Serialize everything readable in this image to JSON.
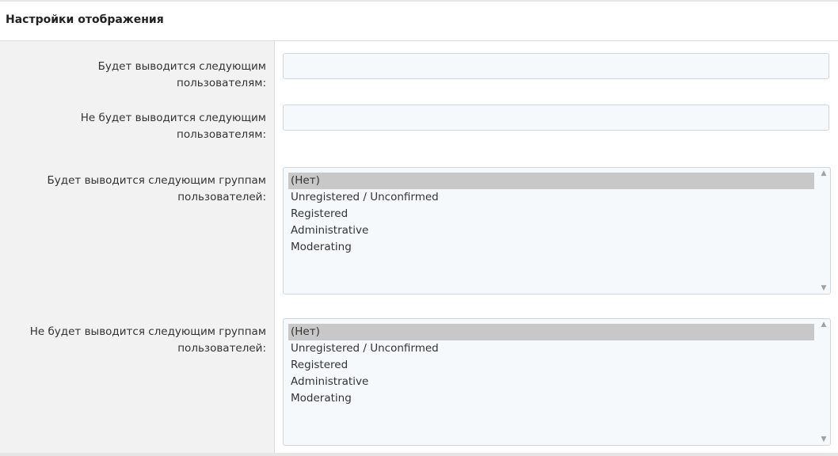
{
  "header": {
    "title": "Настройки отображения"
  },
  "fields": {
    "show_users": {
      "label": "Будет выводится следующим пользователям:",
      "value": ""
    },
    "hide_users": {
      "label_line1": "Не будет выводится следующим",
      "label_line2": "пользователям:",
      "value": ""
    },
    "show_groups": {
      "label_line1": "Будет выводится следующим группам",
      "label_line2": "пользователей:",
      "options": [
        "(Нет)",
        "Unregistered / Unconfirmed",
        "Registered",
        "Administrative",
        "Moderating"
      ],
      "selected": "(Нет)"
    },
    "hide_groups": {
      "label_line1": "Не будет выводится следующим группам",
      "label_line2": "пользователей:",
      "options": [
        "(Нет)",
        "Unregistered / Unconfirmed",
        "Registered",
        "Administrative",
        "Moderating"
      ],
      "selected": "(Нет)"
    }
  },
  "icons": {
    "scroll_up": "chevron-up-icon",
    "scroll_down": "chevron-down-icon"
  },
  "colors": {
    "selected_option_bg": "#c8c8c8",
    "field_bg": "#f6f9fc",
    "label_column_bg": "#f2f2f2"
  }
}
